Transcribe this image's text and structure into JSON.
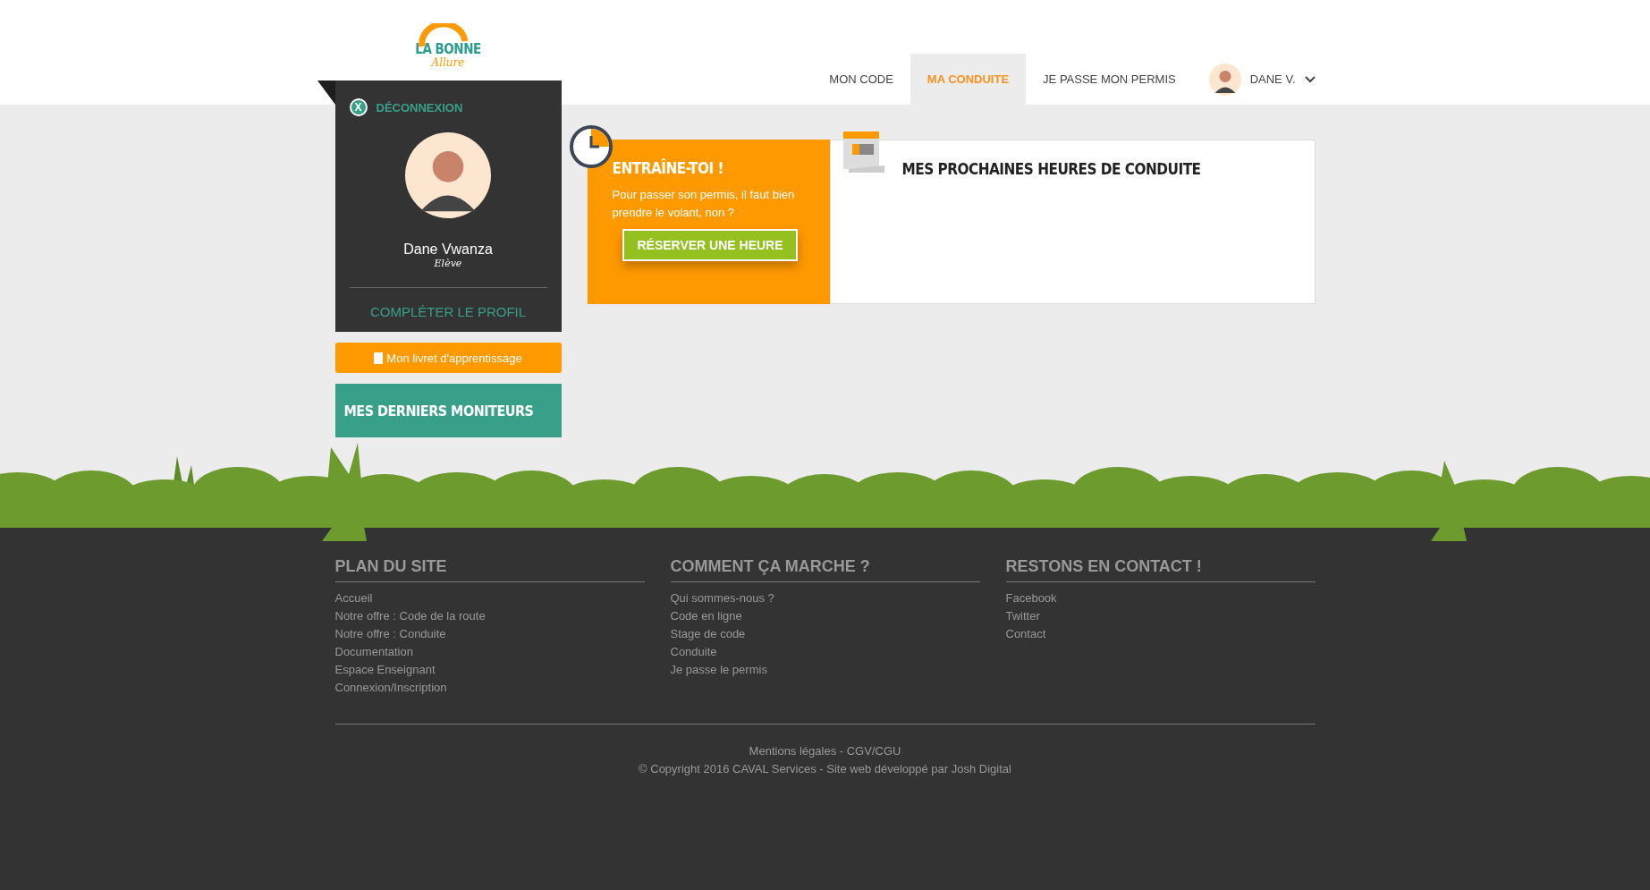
{
  "logo": {
    "line1": "LA BONNE",
    "line2": "Allure"
  },
  "nav": {
    "tabs": [
      {
        "label": "MON CODE",
        "selected": false
      },
      {
        "label": "MA CONDUITE",
        "selected": true
      },
      {
        "label": "JE PASSE MON PERMIS",
        "selected": false
      }
    ],
    "user": "DANE V."
  },
  "profile": {
    "logout_icon": "X",
    "logout": "DÉCONNEXION",
    "name": "Dane Vwanza",
    "role": "Elève",
    "complete": "COMPLÉTER LE PROFIL"
  },
  "booklet_button": "Mon livret d'apprentissage",
  "monitors_title": "MES DERNIERS MONITEURS",
  "practice": {
    "title": "ENTRAÎNE-TOI !",
    "text": "Pour passer son permis, il faut bien prendre le volant, non ?",
    "button": "RÉSERVER UNE HEURE"
  },
  "upcoming": {
    "title": "MES PROCHAINES HEURES DE CONDUITE"
  },
  "footer": {
    "columns": [
      {
        "title": "PLAN DU SITE",
        "links": [
          "Accueil",
          "Notre offre : Code de la route",
          "Notre offre : Conduite",
          "Documentation",
          "Espace Enseignant",
          "Connexion/Inscription"
        ]
      },
      {
        "title": "COMMENT ÇA MARCHE ?",
        "links": [
          "Qui sommes-nous ?",
          "Code en ligne",
          "Stage de code",
          "Conduite",
          "Je passe le permis"
        ]
      },
      {
        "title": "RESTONS EN CONTACT !",
        "links": [
          "Facebook",
          "Twitter",
          "Contact"
        ]
      }
    ],
    "legal": "Mentions légales - CGV/CGU",
    "copyright": "© Copyright 2016 CAVAL Services - Site web développé par Josh Digital"
  }
}
